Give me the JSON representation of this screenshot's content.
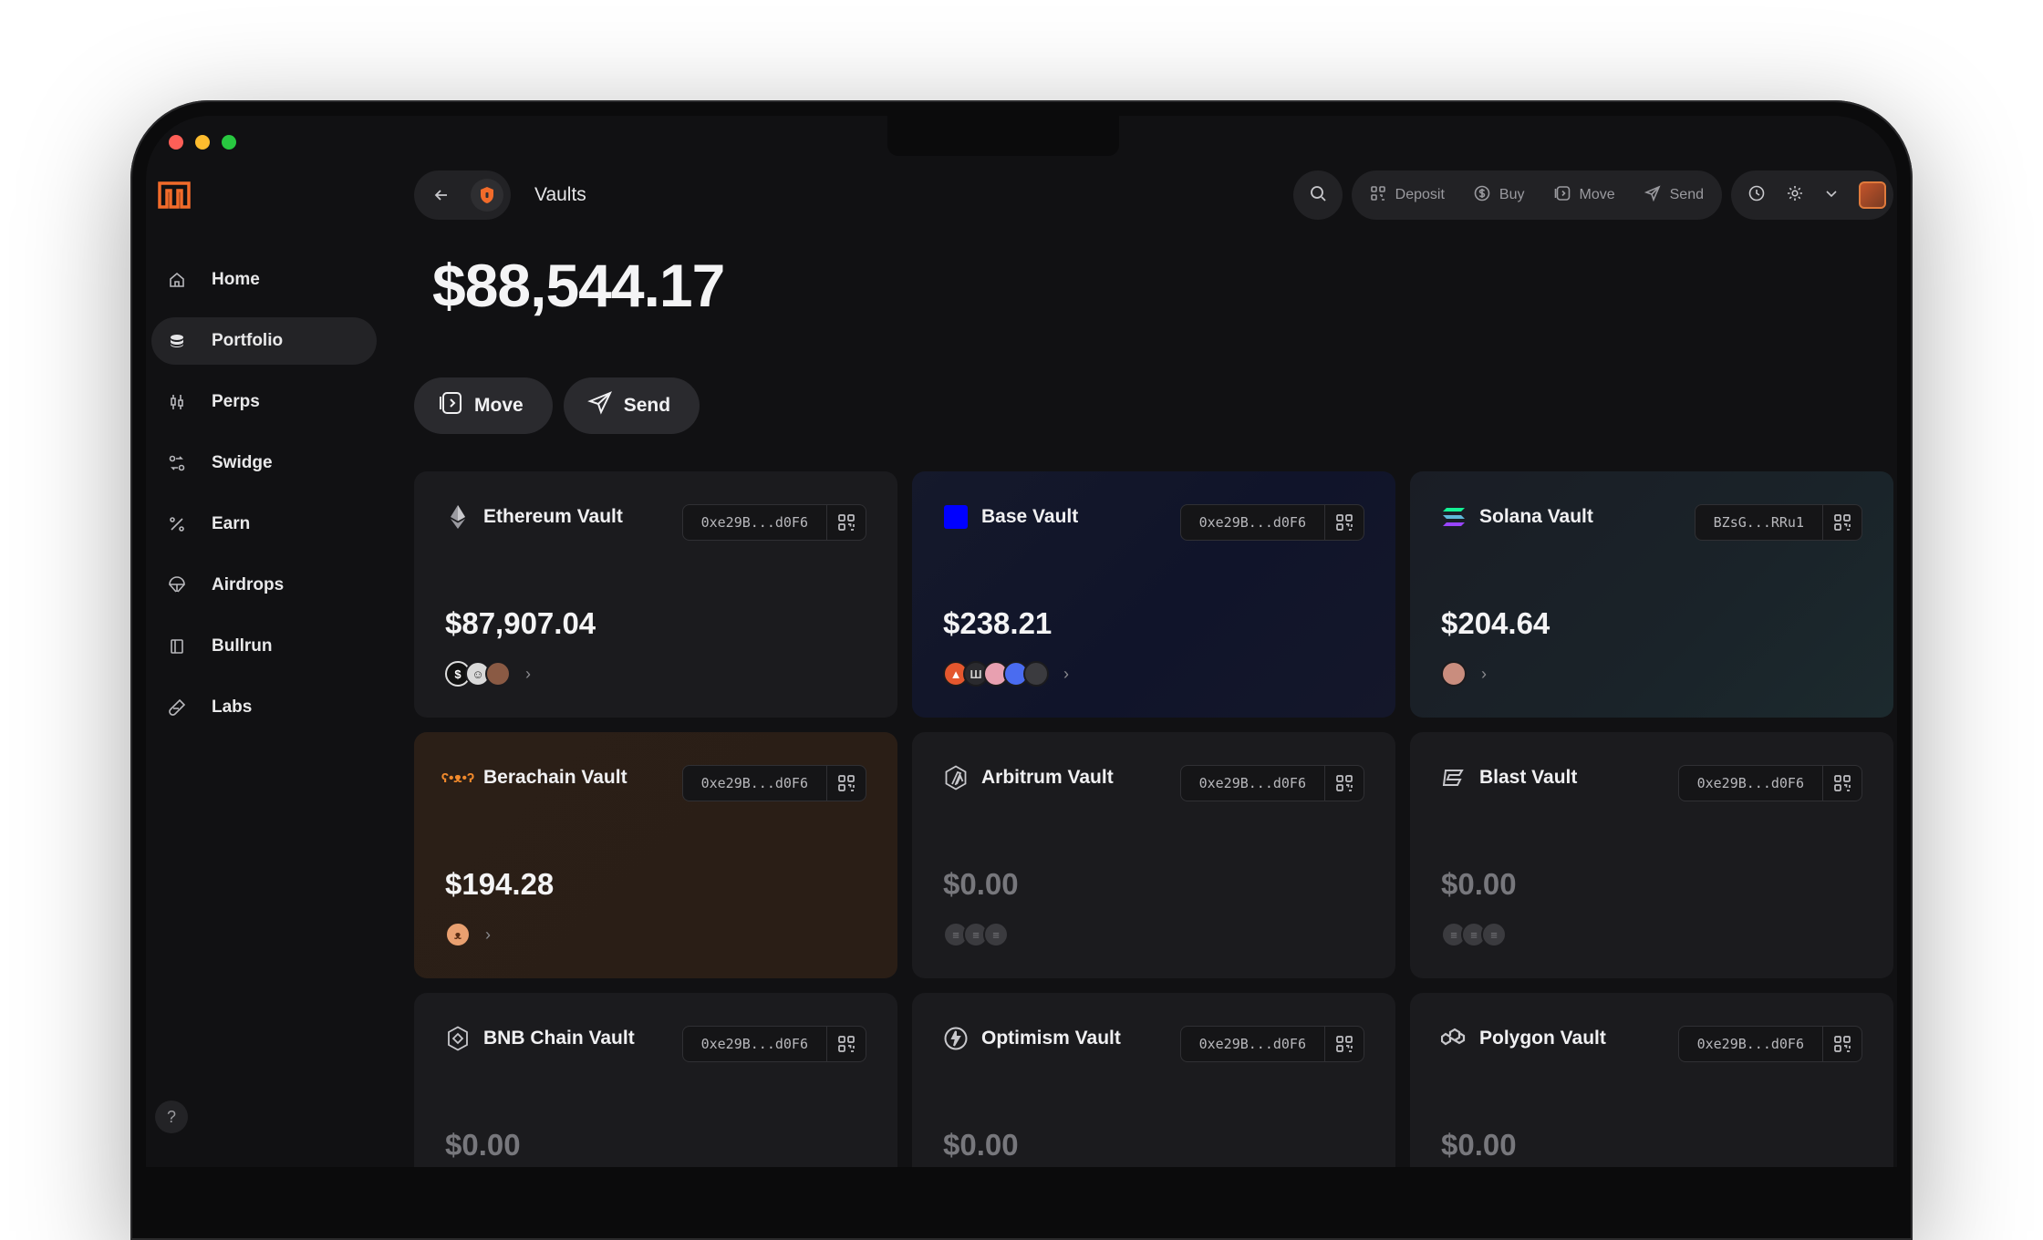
{
  "app": {
    "logo": "bullrun-logo",
    "page_title": "Vaults"
  },
  "sidebar": {
    "items": [
      {
        "label": "Home",
        "icon": "home-icon",
        "active": false
      },
      {
        "label": "Portfolio",
        "icon": "coins-icon",
        "active": true
      },
      {
        "label": "Perps",
        "icon": "candles-icon",
        "active": false
      },
      {
        "label": "Swidge",
        "icon": "swap-icon",
        "active": false
      },
      {
        "label": "Earn",
        "icon": "percent-icon",
        "active": false
      },
      {
        "label": "Airdrops",
        "icon": "parachute-icon",
        "active": false
      },
      {
        "label": "Bullrun",
        "icon": "book-icon",
        "active": false
      },
      {
        "label": "Labs",
        "icon": "flask-icon",
        "active": false
      }
    ],
    "help_icon": "help-icon"
  },
  "topbar": {
    "actions": [
      {
        "label": "Deposit",
        "icon": "qr-icon"
      },
      {
        "label": "Buy",
        "icon": "dollar-icon"
      },
      {
        "label": "Move",
        "icon": "move-icon"
      },
      {
        "label": "Send",
        "icon": "send-icon"
      }
    ]
  },
  "portfolio": {
    "balance": "$88,544.17",
    "move_label": "Move",
    "send_label": "Send"
  },
  "vaults": [
    {
      "name": "Ethereum Vault",
      "address": "0xe29B...d0F6",
      "amount": "$87,907.04",
      "icon": "ethereum-icon",
      "style": "default",
      "zero": false
    },
    {
      "name": "Base Vault",
      "address": "0xe29B...d0F6",
      "amount": "$238.21",
      "icon": "base-icon",
      "style": "base",
      "zero": false
    },
    {
      "name": "Solana Vault",
      "address": "BZsG...RRu1",
      "amount": "$204.64",
      "icon": "solana-icon",
      "style": "sol",
      "zero": false
    },
    {
      "name": "Berachain Vault",
      "address": "0xe29B...d0F6",
      "amount": "$194.28",
      "icon": "berachain-icon",
      "style": "bera",
      "zero": false
    },
    {
      "name": "Arbitrum Vault",
      "address": "0xe29B...d0F6",
      "amount": "$0.00",
      "icon": "arbitrum-icon",
      "style": "default",
      "zero": true
    },
    {
      "name": "Blast Vault",
      "address": "0xe29B...d0F6",
      "amount": "$0.00",
      "icon": "blast-icon",
      "style": "default",
      "zero": true
    },
    {
      "name": "BNB Chain Vault",
      "address": "0xe29B...d0F6",
      "amount": "$0.00",
      "icon": "bnb-icon",
      "style": "default",
      "zero": true
    },
    {
      "name": "Optimism Vault",
      "address": "0xe29B...d0F6",
      "amount": "$0.00",
      "icon": "optimism-icon",
      "style": "default",
      "zero": true
    },
    {
      "name": "Polygon Vault",
      "address": "0xe29B...d0F6",
      "amount": "$0.00",
      "icon": "polygon-icon",
      "style": "default",
      "zero": true
    }
  ],
  "colors": {
    "accent": "#f26b2a",
    "background": "#111113",
    "card": "#1b1b1e",
    "base_blue": "#0000ff"
  }
}
